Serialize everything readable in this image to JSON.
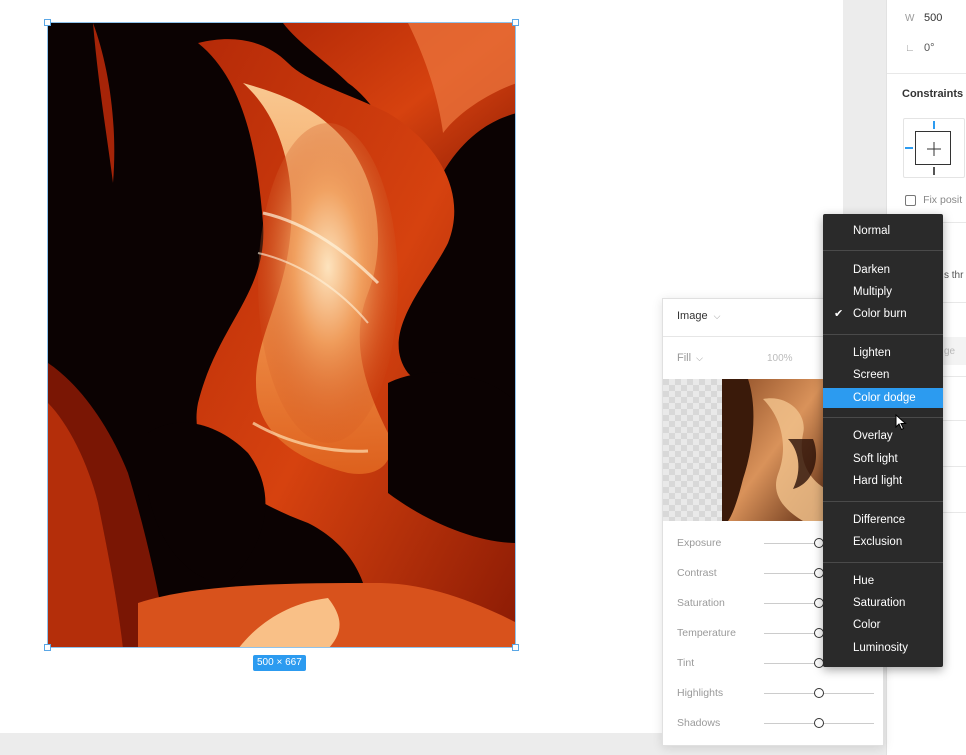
{
  "canvas": {
    "selection_size": "500 × 667"
  },
  "properties": {
    "w_label": "W",
    "w_value": "500",
    "rotation_value": "0°",
    "constraints_title": "Constraints",
    "fix_position_label": "Fix posit",
    "partial_text_1": "s thr",
    "partial_text_2": "ge"
  },
  "image_popover": {
    "title": "Image",
    "fill_mode": "Fill",
    "fill_opacity": "100%",
    "adjustments": [
      {
        "label": "Exposure",
        "value": 0
      },
      {
        "label": "Contrast",
        "value": 0
      },
      {
        "label": "Saturation",
        "value": 0
      },
      {
        "label": "Temperature",
        "value": 0
      },
      {
        "label": "Tint",
        "value": 0
      },
      {
        "label": "Highlights",
        "value": 0
      },
      {
        "label": "Shadows",
        "value": 0
      }
    ]
  },
  "blend_menu": {
    "selected": "Color burn",
    "hovered": "Color dodge",
    "groups": [
      [
        "Normal"
      ],
      [
        "Darken",
        "Multiply",
        "Color burn"
      ],
      [
        "Lighten",
        "Screen",
        "Color dodge"
      ],
      [
        "Overlay",
        "Soft light",
        "Hard light"
      ],
      [
        "Difference",
        "Exclusion"
      ],
      [
        "Hue",
        "Saturation",
        "Color",
        "Luminosity"
      ]
    ]
  },
  "colors": {
    "accent": "#2c9bf0",
    "menu_bg": "#2a2a2a"
  }
}
